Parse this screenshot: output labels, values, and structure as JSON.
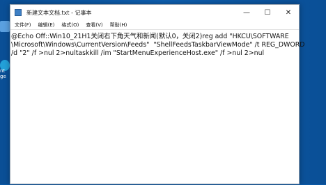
{
  "window": {
    "title": "新建文本文档.txt - 记事本",
    "controls": {
      "minimize": "—",
      "maximize": "☐",
      "close": "✕"
    }
  },
  "menu": [
    {
      "label": "文件(F)"
    },
    {
      "label": "编辑(E)"
    },
    {
      "label": "格式(O)"
    },
    {
      "label": "查看(V)"
    },
    {
      "label": "帮助(H)"
    }
  ],
  "editor": {
    "lines": [
      "@Echo Off::Win10_21H1关闭右下角天气和新闻(默认0，关闭2)reg add \"HKCU\\SOFTWARE",
      "\\Microsoft\\Windows\\CurrentVersion\\Feeds\"  \"ShellFeedsTaskbarViewMode\" /t REG_DWORD",
      "/d \"2\" /f >nul 2>nultaskkill /im \"StartMenuExperienceHost.exe\" /f >nul 2>nul"
    ]
  },
  "desktop": {
    "labels": [
      "",
      "nt",
      "ge"
    ]
  },
  "colors": {
    "desktop_bg": "#0b5aa8",
    "window_bg": "#ffffff",
    "text": "#111111"
  }
}
